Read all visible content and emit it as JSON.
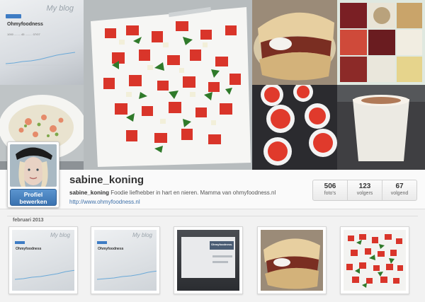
{
  "cover": {
    "blog_label": "My blog",
    "blog_site_name": "Ohmyfoodness",
    "blog_stats": "1000 ........ 45 ......... 07/07"
  },
  "profile": {
    "username": "sabine_koning",
    "edit_button_line1": "Profiel",
    "edit_button_line2": "bewerken",
    "bio_username": "sabine_koning",
    "bio_text": " Foodie liefhebber in hart en nieren. Mamma van ohmyfoodness.nl",
    "website": "http://www.ohmyfoodness.nl"
  },
  "stats": [
    {
      "value": "506",
      "label": "foto's"
    },
    {
      "value": "123",
      "label": "volgers"
    },
    {
      "value": "67",
      "label": "volgend"
    }
  ],
  "feed": {
    "month": "februari 2013",
    "thumb_blog_label": "My blog",
    "thumb_site_name": "Ohmyfoodness",
    "thumb3_title": "Ohmyfoodness."
  },
  "colors": {
    "link": "#3b6ea8",
    "edit_button": "#4a84c0",
    "tomato": "#e0382a",
    "herb": "#2f7a2a"
  }
}
